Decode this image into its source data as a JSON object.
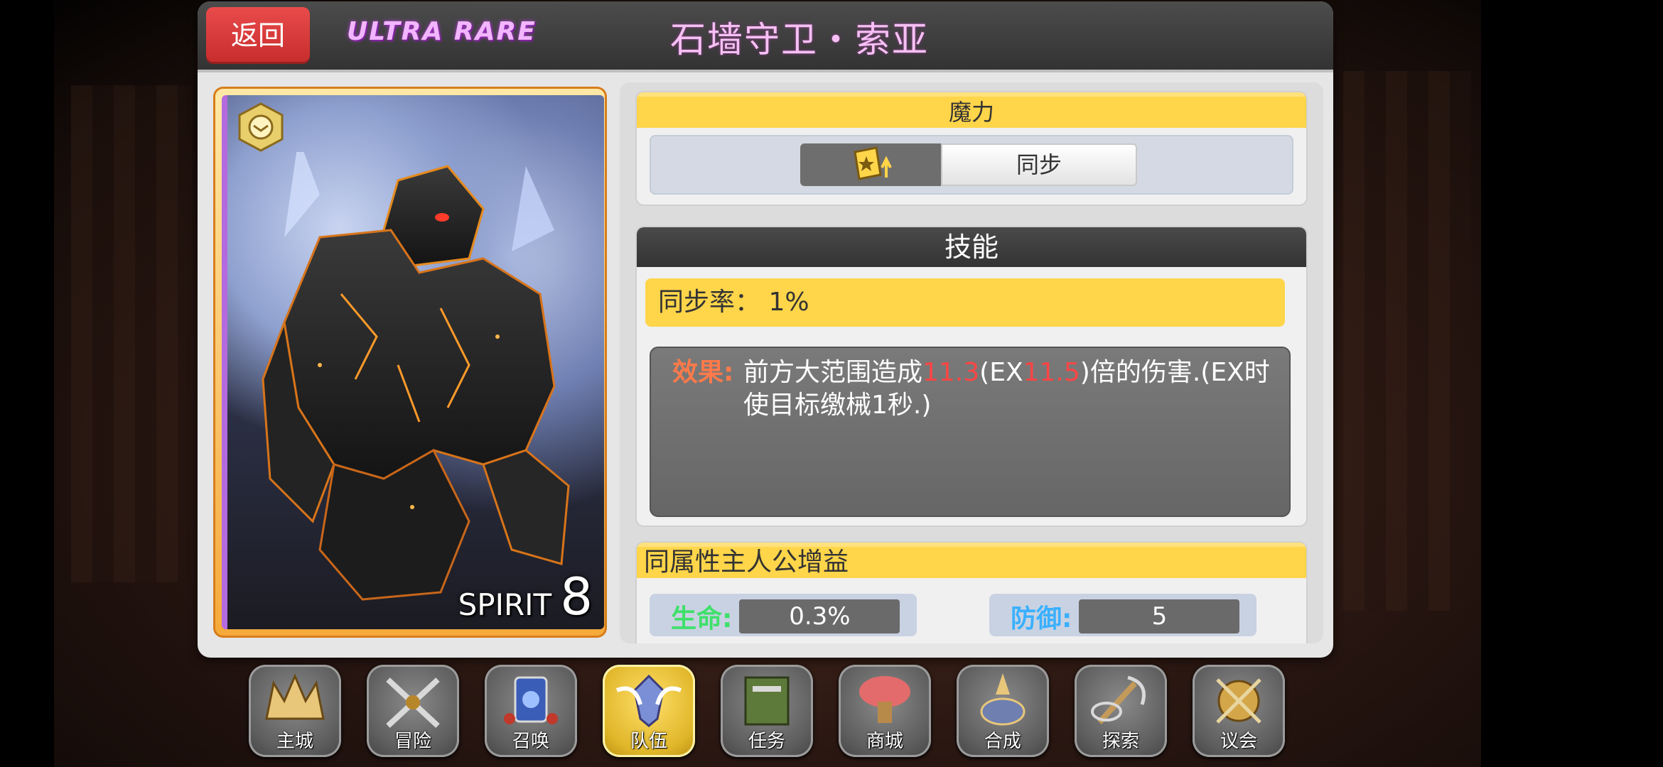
{
  "header": {
    "back_label": "返回",
    "rarity": "ULTRA RARE",
    "card_name": "石墙守卫・索亚"
  },
  "card": {
    "spirit_label": "SPIRIT",
    "spirit_value": "8"
  },
  "magic": {
    "title": "魔力",
    "sync_label": "同步",
    "icon": "star-up-icon"
  },
  "skill": {
    "title": "技能",
    "sync_rate": "同步率： 1%",
    "effect_label": "效果:",
    "effect_parts": {
      "p1": "前方大范围造成",
      "v1": "11.3",
      "p2": "(EX",
      "v2": "11.5",
      "p3": ")倍的伤害.(EX时使目标缴械1秒.)"
    }
  },
  "buff": {
    "title": "同属性主人公增益",
    "hp_label": "生命:",
    "hp_value": "0.3%",
    "def_label": "防御:",
    "def_value": "5"
  },
  "nav": {
    "items": [
      {
        "label": "主城",
        "icon": "castle-icon"
      },
      {
        "label": "冒险",
        "icon": "swords-icon"
      },
      {
        "label": "召唤",
        "icon": "cards-icon"
      },
      {
        "label": "队伍",
        "icon": "team-icon"
      },
      {
        "label": "任务",
        "icon": "book-icon"
      },
      {
        "label": "商城",
        "icon": "shop-icon"
      },
      {
        "label": "合成",
        "icon": "craft-icon"
      },
      {
        "label": "探索",
        "icon": "explore-icon"
      },
      {
        "label": "议会",
        "icon": "council-icon"
      }
    ],
    "active_index": 3
  },
  "colors": {
    "accent_yellow": "#ffd54a",
    "back_red": "#e94b4b",
    "rarity_purple": "#f2b5ff",
    "name_pink": "#f6c0f4",
    "hp_green": "#3ee06a",
    "def_blue": "#3ab0ff",
    "highlight_red": "#ff4545"
  }
}
